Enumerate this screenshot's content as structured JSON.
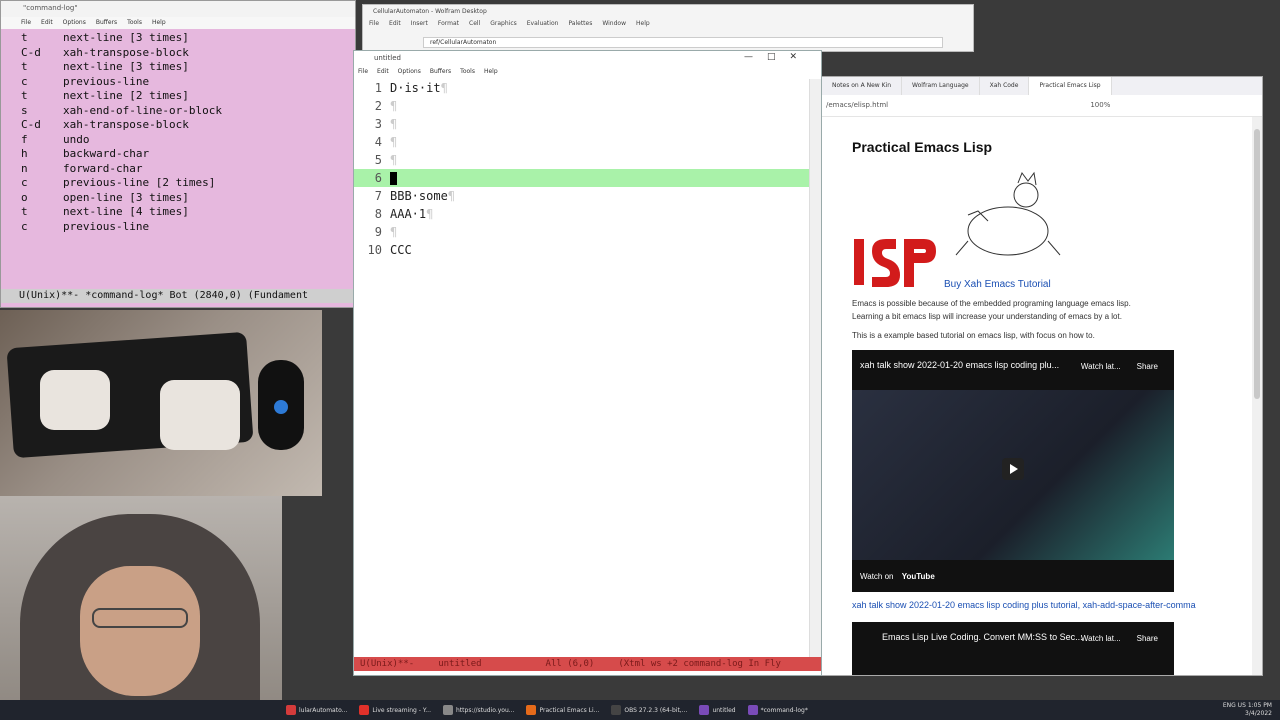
{
  "cmdlog": {
    "title": "\"command-log\"",
    "menu": [
      "File",
      "Edit",
      "Options",
      "Buffers",
      "Tools",
      "Help"
    ],
    "rows": [
      {
        "key": "t",
        "cmd": "next-line [3 times]"
      },
      {
        "key": "C-d",
        "cmd": "xah-transpose-block"
      },
      {
        "key": "t",
        "cmd": "next-line [3 times]"
      },
      {
        "key": "c",
        "cmd": "previous-line"
      },
      {
        "key": "t",
        "cmd": "next-line [2 times]"
      },
      {
        "key": "s",
        "cmd": "xah-end-of-line-or-block"
      },
      {
        "key": "C-d",
        "cmd": "xah-transpose-block"
      },
      {
        "key": "f",
        "cmd": "undo"
      },
      {
        "key": "h",
        "cmd": "backward-char"
      },
      {
        "key": "n",
        "cmd": "forward-char"
      },
      {
        "key": "c",
        "cmd": "previous-line [2 times]"
      },
      {
        "key": "o",
        "cmd": "open-line [3 times]"
      },
      {
        "key": "t",
        "cmd": "next-line [4 times]"
      },
      {
        "key": "c",
        "cmd": "previous-line"
      }
    ],
    "modeline": "U(Unix)**-  *command-log*   Bot (2840,0)   (Fundament"
  },
  "browser_back": {
    "title": "CellularAutomaton - Wolfram Desktop",
    "menu": [
      "File",
      "Edit",
      "Insert",
      "Format",
      "Cell",
      "Graphics",
      "Evaluation",
      "Palettes",
      "Window",
      "Help"
    ],
    "url": "ref/CellularAutomaton"
  },
  "emacs": {
    "title": "untitled",
    "menu": [
      "File",
      "Edit",
      "Options",
      "Buffers",
      "Tools",
      "Help"
    ],
    "lines": [
      {
        "n": "1",
        "text": "D·is·it"
      },
      {
        "n": "2",
        "text": ""
      },
      {
        "n": "3",
        "text": ""
      },
      {
        "n": "4",
        "text": ""
      },
      {
        "n": "5",
        "text": ""
      },
      {
        "n": "6",
        "text": ""
      },
      {
        "n": "7",
        "text": "BBB·some"
      },
      {
        "n": "8",
        "text": "AAA·1"
      },
      {
        "n": "9",
        "text": ""
      },
      {
        "n": "10",
        "text": "CCC"
      }
    ],
    "pilcrow": "¶",
    "modeline": {
      "left": "U(Unix)**-",
      "name": "untitled",
      "pos": "All (6,0)",
      "mode": "(Xtml ws +2 command-log In Fly"
    }
  },
  "firefox": {
    "tabs": [
      "Notes on A New Kin",
      "Wolfram Language",
      "Xah Code",
      "Practical Emacs Lisp"
    ],
    "url": "/emacs/elisp.html",
    "zoom": "100%",
    "page_title": "Practical Emacs Lisp",
    "buy_link": "Buy Xah Emacs Tutorial",
    "para1a": "Emacs is possible because of the embedded programing language emacs lisp.",
    "para1b": "Learning a bit emacs lisp will increase your understanding of emacs by a lot.",
    "para2": "This is a example based tutorial on emacs lisp, with focus on how to.",
    "video1_title": "xah talk show 2022-01-20 emacs lisp coding plu...",
    "watch_later": "Watch lat...",
    "share": "Share",
    "watch_on": "Watch on",
    "youtube": "YouTube",
    "caption_link": "xah talk show 2022-01-20 emacs lisp coding plus tutorial, xah-add-space-after-comma",
    "video2_title": "Emacs Lisp Live Coding. Convert MM:SS to Sec..."
  },
  "taskbar": {
    "items": [
      {
        "label": "lularAutomato...",
        "color": "#d43b3b"
      },
      {
        "label": "Live streaming - Y...",
        "color": "#e0312a"
      },
      {
        "label": "https://studio.you...",
        "color": "#888888"
      },
      {
        "label": "Practical Emacs Li...",
        "color": "#e56a1a"
      },
      {
        "label": "OBS 27.2.3 (64-bit,...",
        "color": "#444444"
      },
      {
        "label": "untitled",
        "color": "#7a4bb8"
      },
      {
        "label": "*command-log*",
        "color": "#7a4bb8"
      }
    ],
    "lang": "ENG US",
    "time": "1:05 PM",
    "date": "3/4/2022"
  }
}
